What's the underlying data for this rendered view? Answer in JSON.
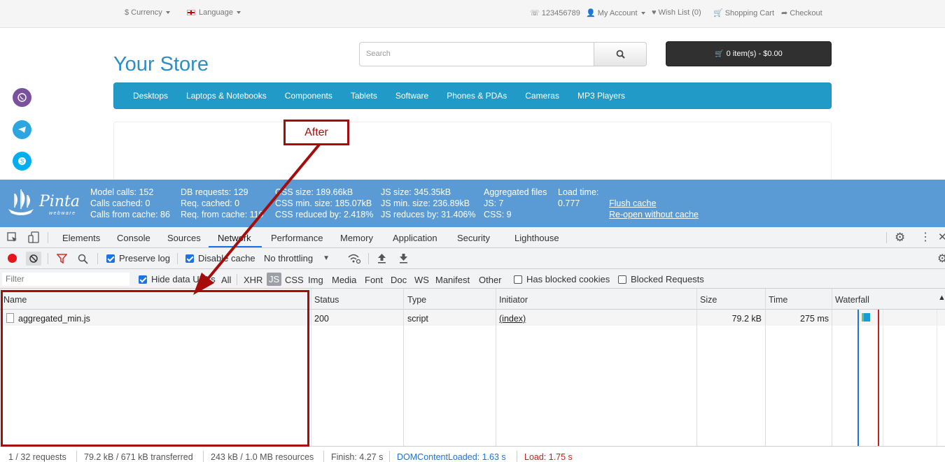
{
  "topbar": {
    "currency": "Currency",
    "language": "Language",
    "phone": "123456789",
    "account": "My Account",
    "wishlist": "Wish List (0)",
    "cart": "Shopping Cart",
    "checkout": "Checkout"
  },
  "header": {
    "logo": "Your Store",
    "search_placeholder": "Search",
    "cart_button": "0 item(s) - $0.00"
  },
  "menu": [
    "Desktops",
    "Laptops & Notebooks",
    "Components",
    "Tablets",
    "Software",
    "Phones & PDAs",
    "Cameras",
    "MP3 Players"
  ],
  "pinta": {
    "logo_text": "Pinta",
    "logo_sub": "webware",
    "c1": [
      "Model calls: 152",
      "Calls cached: 0",
      "Calls from cache: 86"
    ],
    "c2": [
      "DB requests: 129",
      "Req. cached: 0",
      "Req. from cache: 119"
    ],
    "c3": [
      "CSS size: 189.66kB",
      "CSS min. size: 185.07kB",
      "CSS reduced by: 2.418%"
    ],
    "c4": [
      "JS size: 345.35kB",
      "JS min. size: 236.89kB",
      "JS reduces by: 31.406%"
    ],
    "c5": [
      "Aggregated files",
      "JS: 7",
      "CSS: 9"
    ],
    "c6": [
      "Load time:",
      "0.777"
    ],
    "flush": "Flush cache",
    "reopen": "Re-open without cache"
  },
  "devtools": {
    "tabs": [
      "Elements",
      "Console",
      "Sources",
      "Network",
      "Performance",
      "Memory",
      "Application",
      "Security",
      "Lighthouse"
    ],
    "active_tab": "Network",
    "preserve_log": "Preserve log",
    "disable_cache": "Disable cache",
    "throttling": "No throttling",
    "filter_placeholder": "Filter",
    "hide_data_urls": "Hide data URLs",
    "types": [
      "All",
      "XHR",
      "JS",
      "CSS",
      "Img",
      "Media",
      "Font",
      "Doc",
      "WS",
      "Manifest",
      "Other"
    ],
    "has_blocked_cookies": "Has blocked cookies",
    "blocked_requests": "Blocked Requests",
    "columns": [
      "Name",
      "Status",
      "Type",
      "Initiator",
      "Size",
      "Time",
      "Waterfall"
    ],
    "rows": [
      {
        "name": "aggregated_min.js",
        "status": "200",
        "type": "script",
        "initiator": "(index)",
        "size": "79.2 kB",
        "time": "275 ms"
      }
    ],
    "status": {
      "requests": "1 / 32 requests",
      "transferred": "79.2 kB / 671 kB transferred",
      "resources": "243 kB / 1.0 MB resources",
      "finish": "Finish: 4.27 s",
      "dcl": "DOMContentLoaded: 1.63 s",
      "load": "Load: 1.75 s"
    }
  },
  "annotation": {
    "label": "After"
  },
  "colors": {
    "accent": "#229ac8",
    "pinta": "#5b9bd5",
    "annotation": "#a50d0d",
    "dcl": "#1a73e8",
    "load": "#c5221f"
  }
}
